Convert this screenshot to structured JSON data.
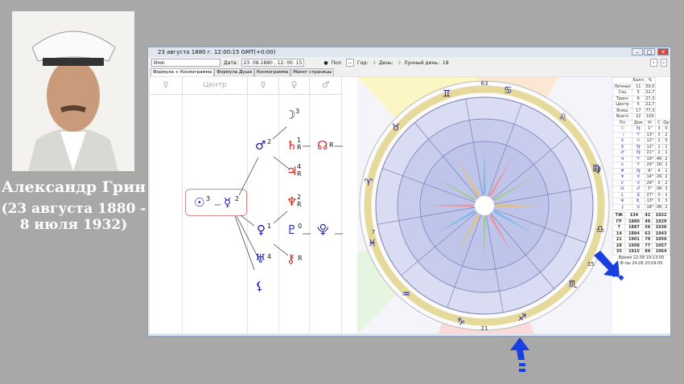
{
  "caption": {
    "name": "Александр Грин",
    "dates_line1": "(23 августа 1880 -",
    "dates_line2": "8 июля 1932)"
  },
  "window": {
    "title": "23 августа 1880 г. 12:00:15 GMT(+0:00)",
    "minimize": "–",
    "maximize": "□",
    "close": "✕"
  },
  "toolbar": {
    "name_label": "Имя:",
    "name_value": "",
    "date_label": "Дата:",
    "date_value": "23. 08.1880 , 12: 00: 15",
    "sex_label": "Пол:",
    "sex_value": "--",
    "year_label": "Год:",
    "day_label": "День:",
    "lunar_day_label": "Лунный день:",
    "lunar_day_value": "18",
    "nav_prev": "‹",
    "nav_next": "›"
  },
  "tabs": [
    {
      "label": "Формула + Космограмма",
      "active": true
    },
    {
      "label": "Формула Души"
    },
    {
      "label": "Космограмма"
    },
    {
      "label": "Макет страницы"
    }
  ],
  "formula": {
    "headers": [
      "☿",
      "Центр",
      "☿",
      "♀",
      "♂"
    ],
    "nodes": [
      {
        "glyph": "☽",
        "sup": "3",
        "color": "blue"
      },
      {
        "glyph": "♂",
        "sup": "2",
        "color": "blue"
      },
      {
        "glyph": "♄",
        "sup": "1",
        "sub": "R",
        "color": "red"
      },
      {
        "glyph": "☊",
        "sup": "R",
        "color": "red"
      },
      {
        "glyph": "♃",
        "sup": "4",
        "sub": "R",
        "color": "red"
      },
      {
        "glyph": "☉",
        "sup": "3",
        "color": "blue"
      },
      {
        "glyph": "☿",
        "sup": "2",
        "color": "blue"
      },
      {
        "glyph": "♆",
        "sup": "2",
        "sub": "R",
        "color": "red"
      },
      {
        "glyph": "♀",
        "sup": "1",
        "color": "blue"
      },
      {
        "glyph": "♇",
        "sup": "0",
        "color": "blue"
      },
      {
        "glyph": "⯓",
        "color": "blue"
      },
      {
        "glyph": "♅",
        "sup": "4",
        "color": "blue"
      },
      {
        "glyph": "⚷",
        "sup": "R",
        "color": "red"
      },
      {
        "glyph": "⚸",
        "color": "blue"
      }
    ]
  },
  "chart": {
    "house_numbers": [
      "63",
      "21",
      "35",
      "7",
      "49"
    ],
    "zodiac": [
      "♈",
      "♉",
      "♊",
      "♋",
      "♌",
      "♍",
      "♎",
      "♏",
      "♐",
      "♑",
      "♒",
      "♓"
    ]
  },
  "table": {
    "score_header": [
      "",
      "Балл",
      "%"
    ],
    "scores": [
      [
        "Личные",
        "11",
        "50,0"
      ],
      [
        "Соц",
        "5",
        "22,7"
      ],
      [
        "Транс",
        "6",
        "27,3"
      ],
      [
        "Центр",
        "5",
        "22,7"
      ],
      [
        "Внеш",
        "17",
        "77,3"
      ],
      [
        "Всего",
        "22",
        "100"
      ]
    ],
    "planet_header": [
      "Пл",
      "Дом",
      "Уг",
      "С",
      "Ор"
    ],
    "planets": [
      [
        "☉",
        "♍",
        "1°",
        "3",
        "0"
      ],
      [
        "☽",
        "♈",
        "13°",
        "3",
        "2"
      ],
      [
        "☿",
        "♌",
        "12°",
        "2",
        "0"
      ],
      [
        "♀",
        "♍",
        "12°",
        "1",
        "1"
      ],
      [
        "♂",
        "♍",
        "21°",
        "2",
        "1"
      ],
      [
        "♃",
        "♈",
        "19°",
        "4R",
        "2"
      ],
      [
        "♄",
        "♈",
        "29°",
        "1R",
        "2"
      ],
      [
        "♅",
        "♍",
        "9°",
        "4",
        "1"
      ],
      [
        "♆",
        "♉",
        "14°",
        "2R",
        "2"
      ],
      [
        "♇",
        "♉",
        "28°",
        "0",
        "2"
      ],
      [
        "☊",
        "♐",
        "5°",
        "0R",
        "3"
      ],
      [
        "⚸",
        "♊",
        "27°",
        "0",
        "1"
      ],
      [
        "⯓",
        "♏",
        "13°",
        "0",
        "3"
      ],
      [
        "⚷",
        "♉",
        "18°",
        "0R",
        "2"
      ]
    ],
    "years": [
      [
        "ТЖ",
        "134",
        "42",
        "1922"
      ],
      [
        "ГР",
        "1880",
        "49",
        "1929"
      ],
      [
        "7",
        "1887",
        "56",
        "1936"
      ],
      [
        "14",
        "1894",
        "63",
        "1943"
      ],
      [
        "21",
        "1901",
        "70",
        "1950"
      ],
      [
        "28",
        "1908",
        "77",
        "1957"
      ],
      [
        "35",
        "1915",
        "84",
        "1964"
      ]
    ],
    "time_line": "Время 22.08 19:13:00",
    "formula_line": "Ф-лы 24.08 20:09:00"
  },
  "colors": {
    "arrow": "#1a3fe0",
    "planet_blue": "#1a1aa8",
    "planet_red": "#d42020"
  }
}
